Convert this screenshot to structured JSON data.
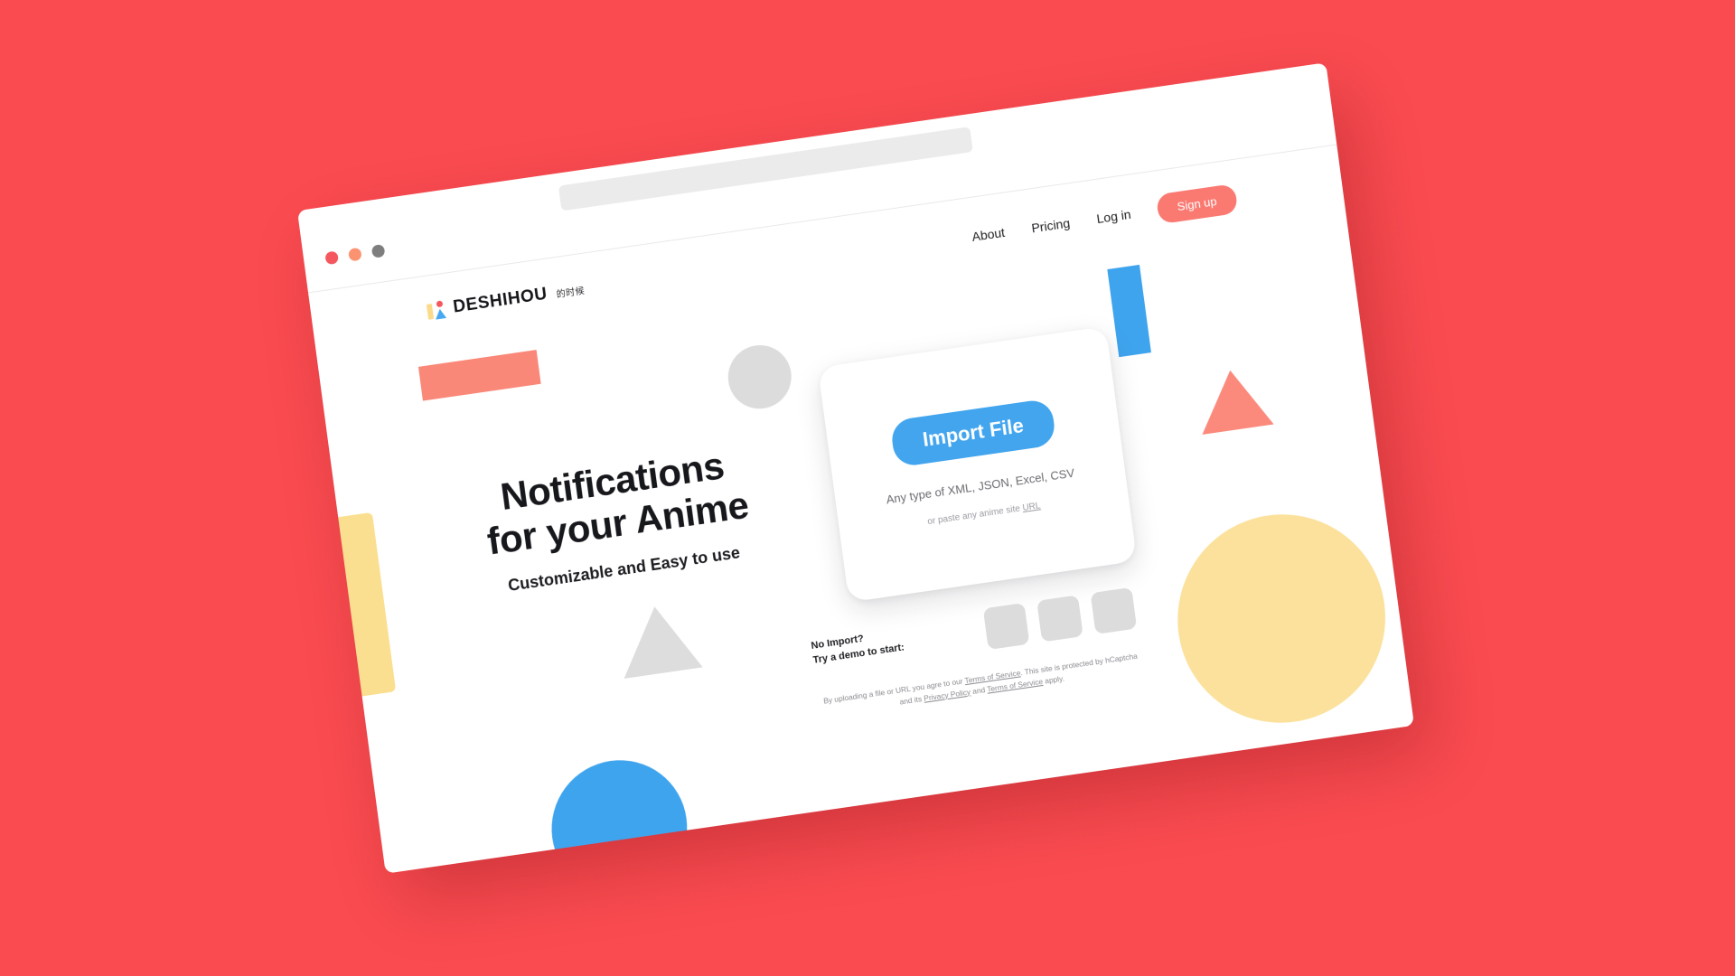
{
  "background": {
    "color": "#FA4B50"
  },
  "browser": {
    "traffic_lights": [
      {
        "name": "close",
        "color": "#F4575E"
      },
      {
        "name": "minimize",
        "color": "#FB9270"
      },
      {
        "name": "maximize",
        "color": "#7E7E7E"
      }
    ],
    "url_value": "",
    "url_placeholder": ""
  },
  "nav": {
    "logo": {
      "text": "DESHIHOU",
      "cn": "的时候"
    },
    "links": [
      {
        "label": "About"
      },
      {
        "label": "Pricing"
      },
      {
        "label": "Log in"
      }
    ],
    "signup_label": "Sign up"
  },
  "hero": {
    "title_line1": "Notifications",
    "title_line2": "for your Anime",
    "subtitle": "Customizable and Easy to use"
  },
  "import": {
    "button_label": "Import File",
    "formats": "Any type of XML, JSON, Excel, CSV",
    "paste_prefix": "or paste any anime site ",
    "paste_link": "URL"
  },
  "demo": {
    "line1": "No Import?",
    "line2": "Try a demo to start:",
    "thumbs": [
      "demo-thumb-1",
      "demo-thumb-2",
      "demo-thumb-3"
    ]
  },
  "legal": {
    "p1a": "By uploading a file or URL you agre to our ",
    "p1link": "Terms of Service",
    "p1b": ". This site is protected by hCaptcha and its ",
    "p2link": "Privacy Policy",
    "p2mid": " and ",
    "p3link": "Terms of Service",
    "p2b": " apply."
  },
  "colors": {
    "brand_red": "#FA4B50",
    "coral": "#FA8878",
    "signup": "#FA7A72",
    "blue": "#42A5EE",
    "yellow": "#FBE19C",
    "grey": "#DCDCDC"
  }
}
